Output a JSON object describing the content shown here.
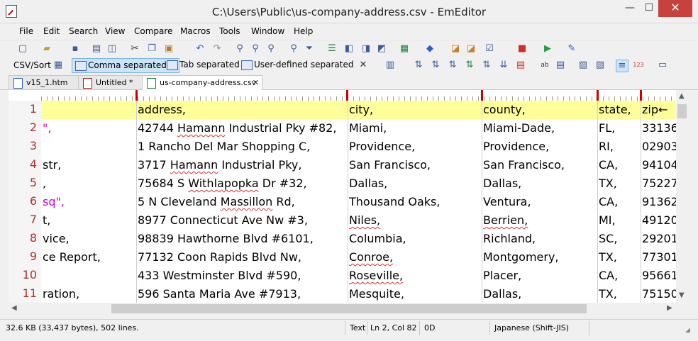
{
  "window": {
    "title": "C:\\Users\\Public\\us-company-address.csv - EmEditor",
    "minimize_glyph": "—",
    "maximize_glyph": "☐",
    "close_glyph": "✕"
  },
  "menu": [
    "File",
    "Edit",
    "Search",
    "View",
    "Compare",
    "Macros",
    "Tools",
    "Window",
    "Help"
  ],
  "csv_toolbar": {
    "label": "CSV/Sort",
    "modes": [
      {
        "label": "Comma separated",
        "active": true
      },
      {
        "label": "Tab separated",
        "active": false
      },
      {
        "label": "User-defined separated",
        "active": false
      }
    ]
  },
  "tabs": [
    {
      "label": "v15_1.htm",
      "active": false
    },
    {
      "label": "Untitled *",
      "active": false
    },
    {
      "label": "us-company-address.csv",
      "active": true
    }
  ],
  "tab_close_glyph": "✕",
  "grid": {
    "header": {
      "line": "1",
      "cells": [
        "",
        "address,",
        "city,",
        "county,",
        "state,",
        "zip←"
      ]
    },
    "rows": [
      {
        "line": "2",
        "cells": [
          "\",",
          "42744 Hamann Industrial Pky #82,",
          "Miami,",
          "Miami-Dade,",
          "FL,",
          "33136"
        ]
      },
      {
        "line": "3",
        "cells": [
          "",
          "1 Rancho Del Mar Shopping C,",
          "Providence,",
          "Providence,",
          "RI,",
          "02903"
        ]
      },
      {
        "line": "4",
        "cells": [
          "str,",
          "3717 Hamann Industrial Pky,",
          "San Francisco,",
          "San Francisco,",
          "CA,",
          "94104"
        ]
      },
      {
        "line": "5",
        "cells": [
          ",",
          "75684 S Withlapopka Dr #32,",
          "Dallas,",
          "Dallas,",
          "TX,",
          "75227"
        ]
      },
      {
        "line": "6",
        "cells": [
          "sq\",",
          "5 N Cleveland Massillon Rd,",
          "Thousand Oaks,",
          "Ventura,",
          "CA,",
          "91362"
        ]
      },
      {
        "line": "7",
        "cells": [
          "t,",
          "8977 Connecticut Ave Nw #3,",
          "Niles,",
          "Berrien,",
          "MI,",
          "49120"
        ]
      },
      {
        "line": "8",
        "cells": [
          "vice,",
          "98839 Hawthorne Blvd #6101,",
          "Columbia,",
          "Richland,",
          "SC,",
          "29201"
        ]
      },
      {
        "line": "9",
        "cells": [
          "ce Report,",
          "77132 Coon Rapids Blvd Nw,",
          "Conroe,",
          "Montgomery,",
          "TX,",
          "77301"
        ]
      },
      {
        "line": "10",
        "cells": [
          "",
          "433 Westminster Blvd #590,",
          "Roseville,",
          "Placer,",
          "CA,",
          "95661"
        ]
      },
      {
        "line": "11",
        "cells": [
          "ration,",
          "596 Santa Maria Ave #7913,",
          "Mesquite,",
          "Dallas,",
          "TX,",
          "75150"
        ]
      }
    ]
  },
  "status": {
    "size": "32.6 KB (33,437 bytes), 502 lines.",
    "mode": "Text",
    "position": "Ln 2, Col 82",
    "char_code": "0D",
    "encoding": "Japanese (Shift-JIS)"
  },
  "colors": {
    "header_row": "#ffff99",
    "line_number": "#b03030",
    "quoted_text": "#cc00cc",
    "close_button": "#c7423c"
  }
}
